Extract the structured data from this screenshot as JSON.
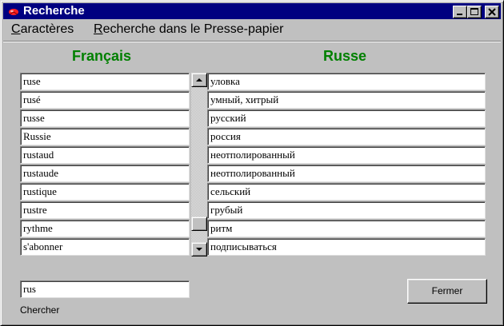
{
  "window": {
    "title": "Recherche"
  },
  "menu": {
    "caracteres": {
      "accel": "C",
      "rest": "aractères"
    },
    "recherche": {
      "accel": "R",
      "rest": "echerche dans le Presse-papier"
    }
  },
  "columns": {
    "french_header": "Français",
    "russian_header": "Russe"
  },
  "rows": [
    {
      "fr": "ruse",
      "ru": "уловка"
    },
    {
      "fr": "rusé",
      "ru": "умный, хитрый"
    },
    {
      "fr": "russe",
      "ru": "русский"
    },
    {
      "fr": "Russie",
      "ru": "россия"
    },
    {
      "fr": "rustaud",
      "ru": "неотполированный"
    },
    {
      "fr": "rustaude",
      "ru": "неотполированный"
    },
    {
      "fr": "rustique",
      "ru": "сельский"
    },
    {
      "fr": "rustre",
      "ru": "грубый"
    },
    {
      "fr": "rythme",
      "ru": "ритм"
    },
    {
      "fr": "s'abonner",
      "ru": "подписываться"
    }
  ],
  "scrollbar": {
    "position": 0.92
  },
  "search": {
    "value": "rus",
    "label": "Chercher"
  },
  "buttons": {
    "close_label": "Fermer"
  },
  "colors": {
    "title_bar": "#000080",
    "header_text": "#008000",
    "window_face": "#c0c0c0"
  },
  "icons": [
    "app-icon",
    "minimize-icon",
    "maximize-icon",
    "close-icon",
    "scroll-up-icon",
    "scroll-down-icon"
  ]
}
